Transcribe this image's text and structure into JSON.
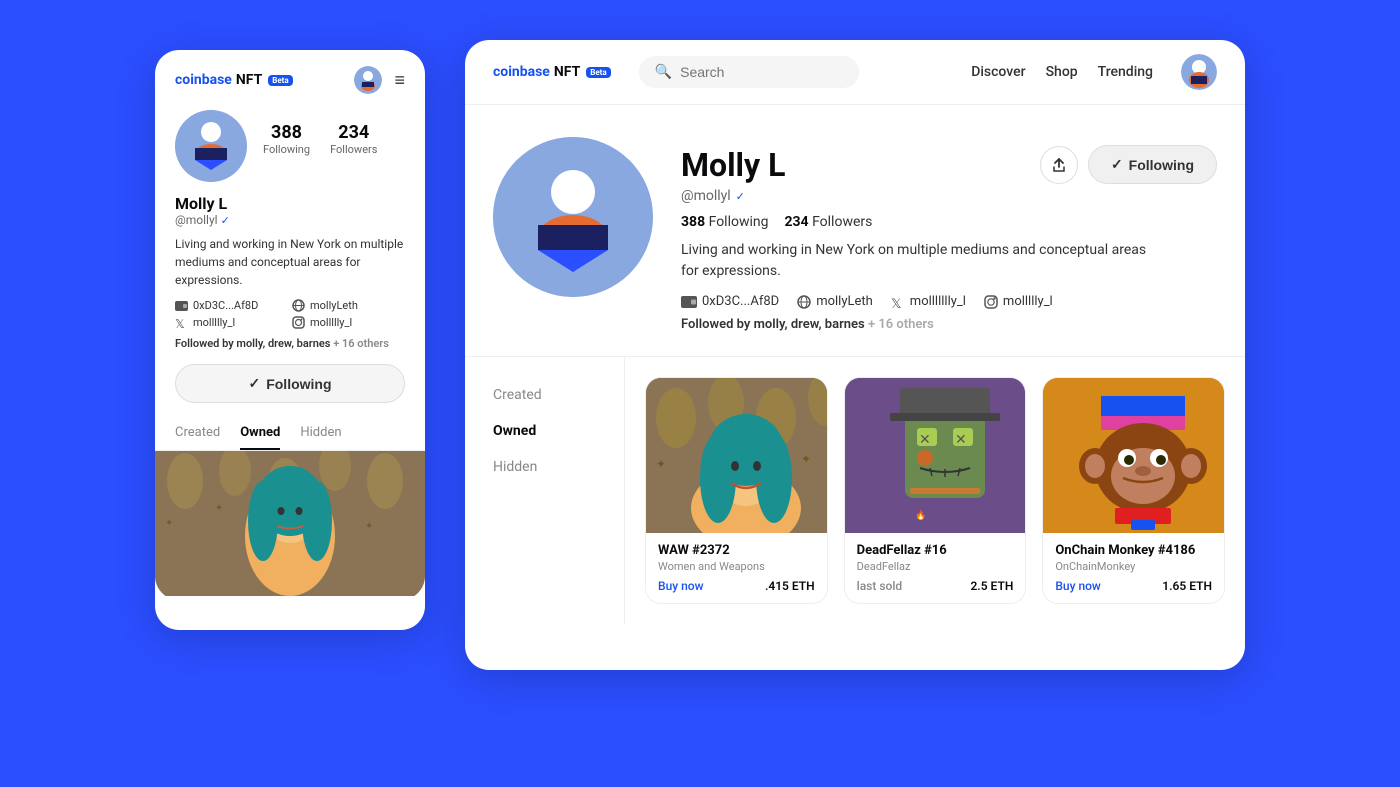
{
  "background_color": "#2B4EFF",
  "mobile": {
    "logo": {
      "coinbase": "coinbase",
      "nft": "NFT",
      "beta": "Beta"
    },
    "profile": {
      "avatar_bg": "#89a8e0",
      "username": "Molly L",
      "handle": "@mollyl",
      "verified": true,
      "bio": "Living and working in New York on multiple mediums and conceptual areas for expressions.",
      "following_count": "388",
      "following_label": "Following",
      "followers_count": "234",
      "followers_label": "Followers",
      "wallet": "0xD3C...Af8D",
      "website": "mollyLeth",
      "twitter": "mollllly_l",
      "instagram": "mollllly_l",
      "followed_by_text": "Followed by",
      "followed_by_names": "molly, drew, barnes",
      "followed_by_others": "+ 16 others"
    },
    "following_button": "Following",
    "tabs": [
      {
        "label": "Created",
        "active": false
      },
      {
        "label": "Owned",
        "active": true
      },
      {
        "label": "Hidden",
        "active": false
      }
    ]
  },
  "desktop": {
    "logo": {
      "coinbase": "coinbase",
      "nft": "NFT",
      "beta": "Beta"
    },
    "nav": {
      "search_placeholder": "Search",
      "discover": "Discover",
      "shop": "Shop",
      "trending": "Trending"
    },
    "profile": {
      "avatar_bg": "#89a8e0",
      "username": "Molly L",
      "handle": "@mollyl",
      "verified": true,
      "following_count": "388",
      "following_label": "Following",
      "followers_count": "234",
      "followers_label": "Followers",
      "bio": "Living and working in New York on multiple mediums and conceptual areas for expressions.",
      "wallet": "0xD3C...Af8D",
      "website": "mollyLeth",
      "twitter": "mollllllly_l",
      "instagram": "mollllly_l",
      "followed_by_text": "Followed by",
      "followed_by_names": "molly, drew, barnes",
      "followed_by_others": "+ 16 others"
    },
    "following_button": "Following",
    "share_button_label": "share",
    "sidebar_tabs": [
      {
        "label": "Created",
        "active": false
      },
      {
        "label": "Owned",
        "active": true
      },
      {
        "label": "Hidden",
        "active": false
      }
    ],
    "nft_grid": [
      {
        "id": "waw",
        "title": "WAW #2372",
        "collection": "Women and Weapons",
        "price_label": "Buy now",
        "price_label_type": "buy",
        "price": ".415 ETH",
        "bg_color": "#8B7355"
      },
      {
        "id": "dead",
        "title": "DeadFellaz #16",
        "collection": "DeadFellaz",
        "price_label": "last sold",
        "price_label_type": "sold",
        "price": "2.5 ETH",
        "bg_color": "#6b4d8a"
      },
      {
        "id": "monkey",
        "title": "OnChain Monkey #4186",
        "collection": "OnChainMonkey",
        "price_label": "Buy now",
        "price_label_type": "buy",
        "price": "1.65 ETH",
        "bg_color": "#d4891a"
      }
    ]
  }
}
